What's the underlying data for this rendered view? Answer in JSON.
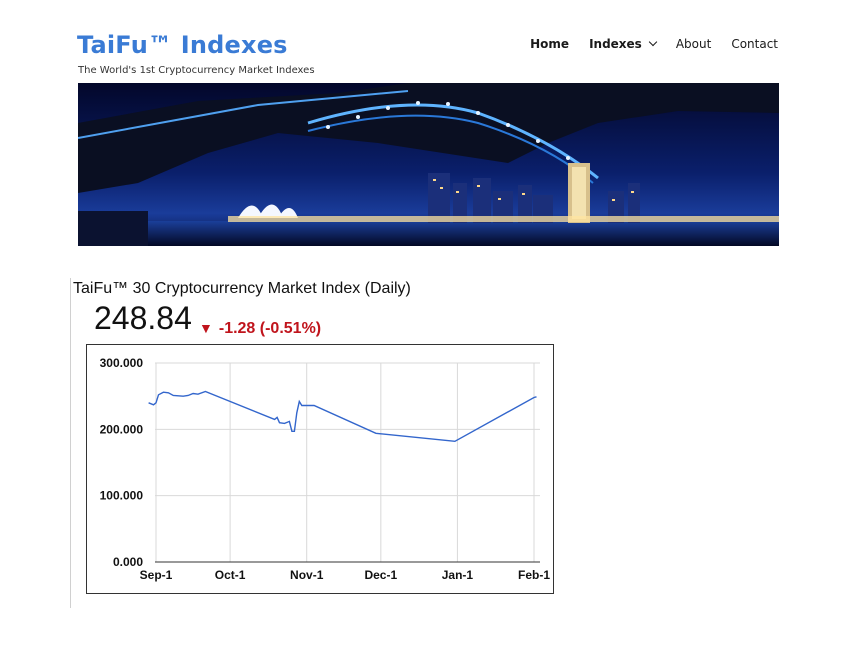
{
  "site": {
    "title": "TaiFu™ Indexes",
    "tagline": "The World's 1st Cryptocurrency Market Indexes"
  },
  "nav": {
    "items": [
      {
        "label": "Home",
        "bold": true
      },
      {
        "label": "Indexes",
        "bold": true,
        "dropdown": true
      },
      {
        "label": "About",
        "bold": false
      },
      {
        "label": "Contact",
        "bold": false
      }
    ]
  },
  "hero": {
    "icon": "sydney-harbour-bridge-night-photo"
  },
  "widget": {
    "title": "TaiFu™ 30 Cryptocurrency Market Index (Daily)",
    "price": "248.84",
    "change_symbol": "▼",
    "change": "-1.28 (-0.51%)",
    "change_color": "#c0141c"
  },
  "chart_data": {
    "type": "line",
    "title": "",
    "xlabel": "",
    "ylabel": "",
    "x_ticks": [
      "Sep-1",
      "Oct-1",
      "Nov-1",
      "Dec-1",
      "Jan-1",
      "Feb-1"
    ],
    "y_ticks": [
      "0.000",
      "100.000",
      "200.000",
      "300.000"
    ],
    "ylim": [
      0,
      300
    ],
    "grid": true,
    "line_color": "#3366cc",
    "series": [
      {
        "x": [
          "Aug-29",
          "Aug-31",
          "Sep-1",
          "Sep-2",
          "Sep-4",
          "Sep-6",
          "Sep-8",
          "Sep-12",
          "Sep-14",
          "Sep-16",
          "Sep-18",
          "Sep-21",
          "Oct-19",
          "Oct-20",
          "Oct-21",
          "Oct-23",
          "Oct-25",
          "Oct-26",
          "Oct-27",
          "Oct-28",
          "Oct-29",
          "Oct-30",
          "Nov-1",
          "Nov-3",
          "Nov-4",
          "Nov-29",
          "Dec-31",
          "Feb-1",
          "Feb-2"
        ],
        "values": [
          240,
          237,
          240,
          252,
          256,
          255,
          251,
          250,
          251,
          254,
          253,
          257,
          215,
          218,
          210,
          209,
          212,
          197,
          197,
          225,
          242,
          236,
          236,
          236,
          236,
          194,
          182,
          248,
          249
        ]
      }
    ]
  },
  "footer": {
    "cut_text": ""
  }
}
